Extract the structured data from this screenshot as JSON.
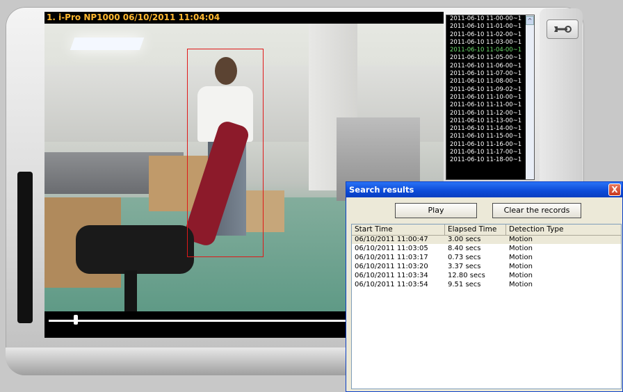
{
  "player": {
    "title": "1. i-Pro NP1000 06/10/2011 11:04:04"
  },
  "records": {
    "items": [
      "2011-06-10 11-00-00~1",
      "2011-06-10 11-01-00~1",
      "2011-06-10 11-02-00~1",
      "2011-06-10 11-03-00~1",
      "2011-06-10 11-04-00~1",
      "2011-06-10 11-05-00~1",
      "2011-06-10 11-06-00~1",
      "2011-06-10 11-07-00~1",
      "2011-06-10 11-08-00~1",
      "2011-06-10 11-09-02~1",
      "2011-06-10 11-10-00~1",
      "2011-06-10 11-11-00~1",
      "2011-06-10 11-12-00~1",
      "2011-06-10 11-13-00~1",
      "2011-06-10 11-14-00~1",
      "2011-06-10 11-15-00~1",
      "2011-06-10 11-16-00~1",
      "2011-06-10 11-17-00~1",
      "2011-06-10 11-18-00~1"
    ],
    "active_index": 4,
    "scroll_up_glyph": "^"
  },
  "dialog": {
    "title": "Search results",
    "close_glyph": "X",
    "play_label": "Play",
    "clear_label": "Clear the records",
    "columns": [
      "Start Time",
      "Elapsed Time",
      "Detection Type"
    ],
    "rows": [
      {
        "start": "06/10/2011 11:00:47",
        "elapsed": "3.00 secs",
        "type": "Motion"
      },
      {
        "start": "06/10/2011 11:03:05",
        "elapsed": "8.40 secs",
        "type": "Motion"
      },
      {
        "start": "06/10/2011 11:03:17",
        "elapsed": "0.73 secs",
        "type": "Motion"
      },
      {
        "start": "06/10/2011 11:03:20",
        "elapsed": "3.37 secs",
        "type": "Motion"
      },
      {
        "start": "06/10/2011 11:03:34",
        "elapsed": "12.80 secs",
        "type": "Motion"
      },
      {
        "start": "06/10/2011 11:03:54",
        "elapsed": "9.51 secs",
        "type": "Motion"
      }
    ],
    "selected_row": 0
  },
  "colors": {
    "title_text": "#ffb830",
    "active_record": "#6fe06f",
    "bbox": "#e01818",
    "dialog_titlebar": "#0b4ad7"
  },
  "icons": {
    "settings": "wrench-icon"
  }
}
